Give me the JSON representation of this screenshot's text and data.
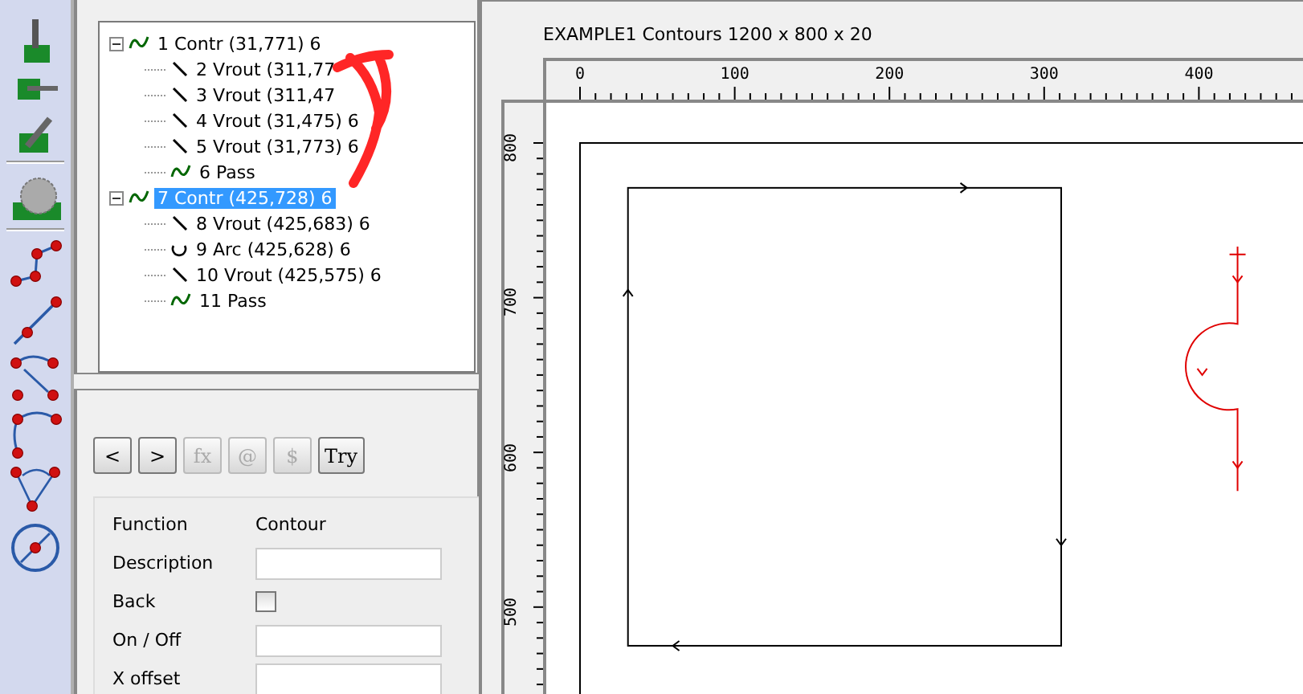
{
  "tree": [
    {
      "label": "1 Contr  (31,771) 6",
      "kind": "contour",
      "selected": false,
      "expanded": true,
      "children": [
        {
          "label": "2 Vrout  (311,77",
          "kind": "line",
          "selected": false
        },
        {
          "label": "3 Vrout  (311,47",
          "kind": "line",
          "selected": false
        },
        {
          "label": "4 Vrout  (31,475) 6",
          "kind": "line",
          "selected": false
        },
        {
          "label": "5 Vrout  (31,773) 6",
          "kind": "line",
          "selected": false
        },
        {
          "label": "6 Pass",
          "kind": "pass",
          "selected": false
        }
      ]
    },
    {
      "label": "7 Contr  (425,728) 6",
      "kind": "contour",
      "selected": true,
      "expanded": true,
      "children": [
        {
          "label": "8 Vrout  (425,683) 6",
          "kind": "line",
          "selected": false
        },
        {
          "label": "9 Arc  (425,628) 6",
          "kind": "arc",
          "selected": false
        },
        {
          "label": "10 Vrout  (425,575) 6",
          "kind": "line",
          "selected": false
        },
        {
          "label": "11 Pass",
          "kind": "pass",
          "selected": false
        }
      ]
    }
  ],
  "buttons": [
    {
      "label": "<",
      "disabled": false
    },
    {
      "label": ">",
      "disabled": false
    },
    {
      "label": "fx",
      "disabled": true
    },
    {
      "label": "@",
      "disabled": true
    },
    {
      "label": "$",
      "disabled": true
    },
    {
      "label": "Try",
      "disabled": false
    }
  ],
  "form": [
    {
      "kind": "text",
      "label": "Function",
      "value": "Contour"
    },
    {
      "kind": "field",
      "label": "Description"
    },
    {
      "kind": "checkbox",
      "label": "Back",
      "checked": false
    },
    {
      "kind": "field",
      "label": "On / Off"
    },
    {
      "kind": "field",
      "label": "X offset"
    }
  ],
  "view": {
    "title": "EXAMPLE1 Contours  1200 x 800 x 20",
    "x_ruler": [
      "0",
      "100",
      "200",
      "300",
      "400"
    ],
    "y_ruler": [
      "800",
      "700",
      "600",
      "500"
    ]
  }
}
